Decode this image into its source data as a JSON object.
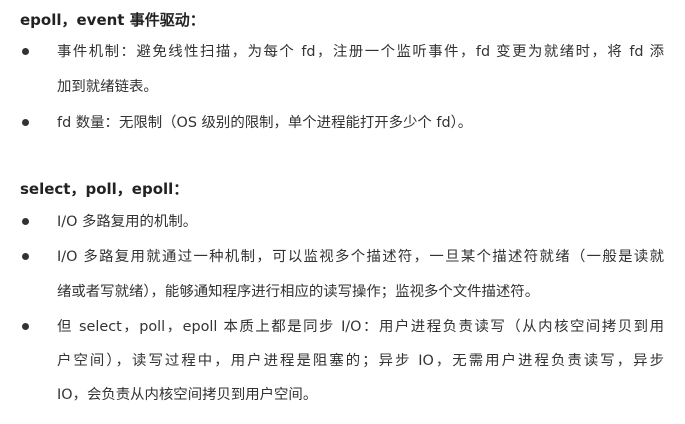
{
  "sections": [
    {
      "heading": "epoll，event 事件驱动：",
      "items": [
        {
          "lines": [
            "事件机制：避免线性扫描，为每个 fd，注册一个监听事件，fd 变更为就绪时，将 fd 添",
            "加到就绪链表。"
          ]
        },
        {
          "lines": [
            "fd 数量：无限制（OS 级别的限制，单个进程能打开多少个 fd）。"
          ]
        }
      ]
    },
    {
      "heading": "select，poll，epoll：",
      "items": [
        {
          "lines": [
            "I/O 多路复用的机制。"
          ]
        },
        {
          "lines": [
            "I/O 多路复用就通过一种机制，可以监视多个描述符，一旦某个描述符就绪（一般是读就",
            "绪或者写就绪），能够通知程序进行相应的读写操作；监视多个文件描述符。"
          ]
        },
        {
          "lines": [
            "但 select，poll，epoll 本质上都是同步 I/O：用户进程负责读写（从内核空间拷贝到用",
            "户空间），读写过程中，用户进程是阻塞的；异步 IO，无需用户进程负责读写，异步",
            "IO，会负责从内核空间拷贝到用户空间。"
          ]
        }
      ]
    }
  ]
}
